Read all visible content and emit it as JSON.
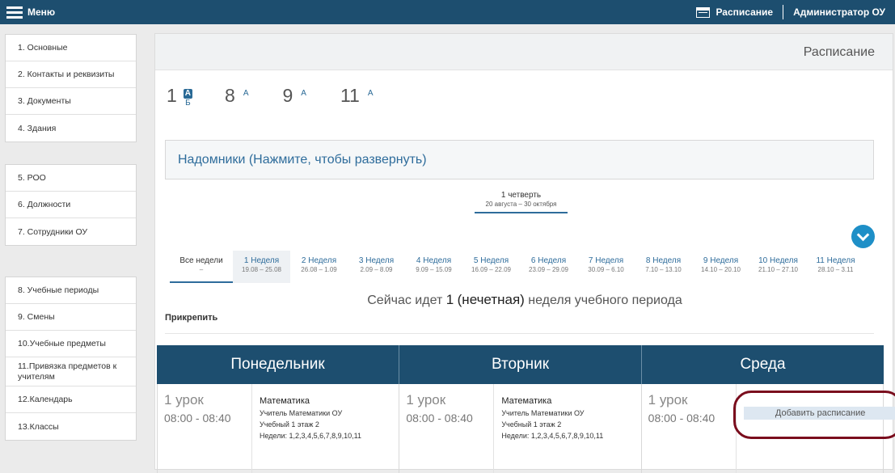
{
  "topbar": {
    "menu_label": "Меню",
    "schedule_link": "Расписание",
    "admin_label": "Администратор ОУ"
  },
  "sidebar": {
    "groups": [
      [
        "1.  Основные",
        "2.  Контакты и реквизиты",
        "3.  Документы",
        "4.  Здания"
      ],
      [
        "5.  РОО",
        "6.  Должности",
        "7.  Сотрудники ОУ"
      ],
      [
        "8.  Учебные периоды",
        "9.  Смены",
        "10.Учебные предметы",
        "11.Привязка предметов к учителям",
        "12.Календарь",
        "13.Классы"
      ]
    ]
  },
  "page": {
    "title": "Расписание",
    "classes": [
      {
        "num": "1",
        "letters": [
          "А",
          "Б"
        ]
      },
      {
        "num": "8",
        "letters": [
          "А"
        ]
      },
      {
        "num": "9",
        "letters": [
          "А"
        ]
      },
      {
        "num": "11",
        "letters": [
          "А"
        ]
      }
    ],
    "homebound": "Надомники (Нажмите, чтобы развернуть)",
    "quarter": {
      "title": "1 четверть",
      "dates": "20 августа – 30 октября"
    },
    "weeks": [
      {
        "name": "Все недели",
        "dates": "–"
      },
      {
        "name": "1 Неделя",
        "dates": "19.08 – 25.08"
      },
      {
        "name": "2 Неделя",
        "dates": "26.08 – 1.09"
      },
      {
        "name": "3 Неделя",
        "dates": "2.09 – 8.09"
      },
      {
        "name": "4 Неделя",
        "dates": "9.09 – 15.09"
      },
      {
        "name": "5 Неделя",
        "dates": "16.09 – 22.09"
      },
      {
        "name": "6 Неделя",
        "dates": "23.09 – 29.09"
      },
      {
        "name": "7 Неделя",
        "dates": "30.09 – 6.10"
      },
      {
        "name": "8 Неделя",
        "dates": "7.10 – 13.10"
      },
      {
        "name": "9 Неделя",
        "dates": "14.10 – 20.10"
      },
      {
        "name": "10 Неделя",
        "dates": "21.10 – 27.10"
      },
      {
        "name": "11 Неделя",
        "dates": "28.10 – 3.11"
      }
    ],
    "now_prefix": "Сейчас идет ",
    "now_number": "1",
    "now_parity": "(нечетная)",
    "now_suffix": " неделя учебного периода",
    "attach_label": "Прикрепить"
  },
  "schedule": {
    "days": [
      {
        "name": "Понедельник",
        "lesson": "1 урок",
        "time": "08:00 - 08:40",
        "subject": "Математика",
        "teacher": "Учитель Математики ОУ",
        "room": "Учебный 1 этаж 2",
        "weeks": "Недели: 1,2,3,4,5,6,7,8,9,10,11"
      },
      {
        "name": "Вторник",
        "lesson": "1 урок",
        "time": "08:00 - 08:40",
        "subject": "Математика",
        "teacher": "Учитель Математики ОУ",
        "room": "Учебный 1 этаж 2",
        "weeks": "Недели: 1,2,3,4,5,6,7,8,9,10,11"
      },
      {
        "name": "Среда",
        "lesson": "1 урок",
        "time": "08:00 - 08:40",
        "add_label": "Добавить расписание"
      }
    ]
  },
  "colors": {
    "topbar": "#1d4e6f",
    "accent": "#2e6c9b",
    "highlight_circle": "#7a0d1d",
    "down_button": "#1e8fc7"
  }
}
